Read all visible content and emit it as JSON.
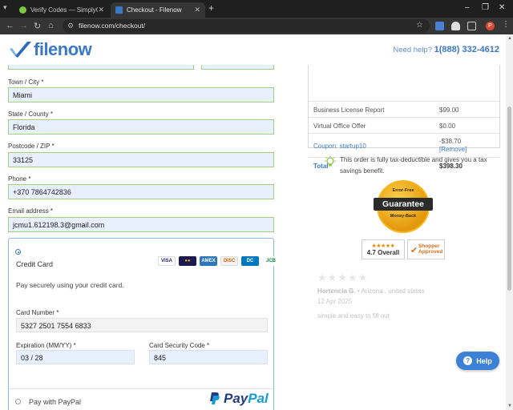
{
  "browser": {
    "tabs": [
      {
        "title": "Verify Codes — SimplyCodes",
        "favicon_color": "#7ac943"
      },
      {
        "title": "Checkout - Filenow",
        "favicon_color": "#3b78c7"
      }
    ],
    "url": "filenow.com/checkout/",
    "profile_initial": "P"
  },
  "header": {
    "logo_text": "filenow",
    "need_help": "Need help?",
    "phone": "1(888) 332-4612"
  },
  "form": {
    "city_label": "Town / City *",
    "city_value": "Miami",
    "state_label": "State / County *",
    "state_value": "Florida",
    "zip_label": "Postcode / ZIP *",
    "zip_value": "33125",
    "phone_label": "Phone *",
    "phone_value": "+370 7864742836",
    "email_label": "Email address *",
    "email_value": "jcmu1.612198.3@gmail.com"
  },
  "payment": {
    "credit_card_label": "Credit Card",
    "description": "Pay securely using your credit card.",
    "card_number_label": "Card Number *",
    "card_number_value": "5327 2501 7554 6833",
    "expiration_label": "Expiration (MM/YY) *",
    "expiration_value": "03 / 28",
    "cvc_label": "Card Security Code *",
    "cvc_value": "845",
    "paypal_label": "Pay with PayPal",
    "paypal_logo_pay": "Pay",
    "paypal_logo_pal": "Pal",
    "card_brands": [
      "VISA",
      "MC",
      "AMEX",
      "DISC",
      "DC",
      "JCB"
    ]
  },
  "summary": {
    "rows": [
      {
        "label": "Business License Report",
        "value": "$99.00"
      },
      {
        "label": "Virtual Office Offer",
        "value": "$0.00"
      }
    ],
    "coupon_label": "Coupon: startup10",
    "coupon_value": "-$38.70",
    "coupon_remove": "[Remove]",
    "total_label": "Total",
    "total_value": "$398.30"
  },
  "tax_note": "This order is fully tax-deductible and gives you a tax savings benefit.",
  "guarantee": {
    "top": "Error-Free",
    "main": "Guarantee",
    "bottom": "Money-Back"
  },
  "badges": {
    "overall_stars": "★★★★★",
    "overall_text": "4.7 Overall",
    "shopper_line1": "Shopper",
    "shopper_line2": "Approved"
  },
  "review": {
    "stars": "★★★★★",
    "name": "Hortencia G.",
    "location": "• Arizona , united states",
    "date": "12 Apr 2025",
    "text": "simple and easy to fill out"
  },
  "help_button": "Help"
}
